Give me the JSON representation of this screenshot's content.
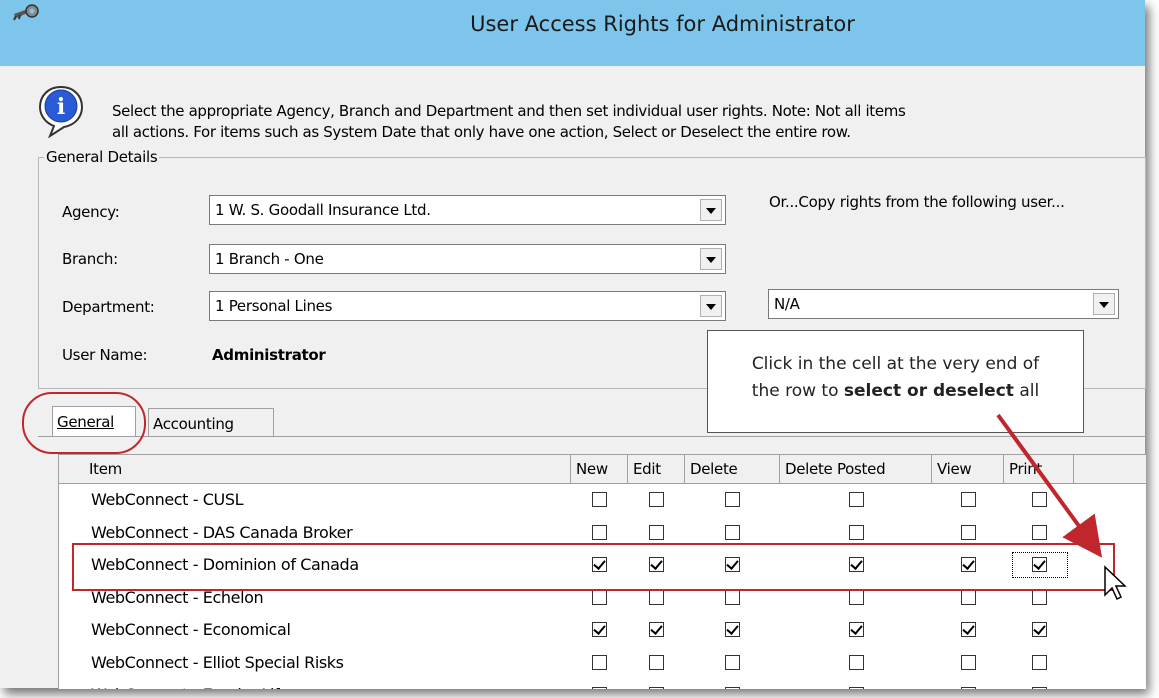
{
  "window": {
    "title": "User Access Rights for Administrator"
  },
  "info": {
    "icon": "info-icon",
    "line1": "Select the appropriate Agency, Branch and Department and then set individual user rights.  Note:  Not all items",
    "line2": "all actions.  For items such as System Date that only have one action, Select or Deselect the entire row."
  },
  "general_details": {
    "legend": "General Details",
    "agency_label": "Agency:",
    "agency_value": "1 W. S. Goodall Insurance Ltd.",
    "branch_label": "Branch:",
    "branch_value": "1 Branch - One",
    "department_label": "Department:",
    "department_value": "1 Personal Lines",
    "user_name_label": "User Name:",
    "user_name_value": "Administrator",
    "copy_label": "Or...Copy rights from the following user...",
    "copy_value": "N/A"
  },
  "callout": {
    "line1": "Click in the cell at the very end of",
    "line2_prefix": "the row to ",
    "line2_bold": "select or deselect",
    "line2_suffix": " all"
  },
  "tabs": [
    {
      "label": "General",
      "active": true
    },
    {
      "label": "Accounting",
      "active": false
    }
  ],
  "grid": {
    "headers": [
      "Item",
      "New",
      "Edit",
      "Delete",
      "Delete Posted",
      "View",
      "Print"
    ],
    "rows": [
      {
        "item": "WebConnect - CUSL",
        "checks": [
          false,
          false,
          false,
          false,
          false,
          false
        ]
      },
      {
        "item": "WebConnect - DAS Canada Broker",
        "checks": [
          false,
          false,
          false,
          false,
          false,
          false
        ]
      },
      {
        "item": "WebConnect - Dominion of Canada",
        "checks": [
          true,
          true,
          true,
          true,
          true,
          true
        ]
      },
      {
        "item": "WebConnect - Echelon",
        "checks": [
          false,
          false,
          false,
          false,
          false,
          false
        ]
      },
      {
        "item": "WebConnect - Economical",
        "checks": [
          true,
          true,
          true,
          true,
          true,
          true
        ]
      },
      {
        "item": "WebConnect - Elliot Special Risks",
        "checks": [
          false,
          false,
          false,
          false,
          false,
          false
        ]
      },
      {
        "item": "WebConnect - Empire Life",
        "checks": [
          false,
          false,
          false,
          false,
          false,
          false
        ]
      }
    ]
  },
  "colors": {
    "titlebar": "#7ec5ec",
    "highlight": "#c0272d",
    "window_bg": "#f0f0f0"
  }
}
